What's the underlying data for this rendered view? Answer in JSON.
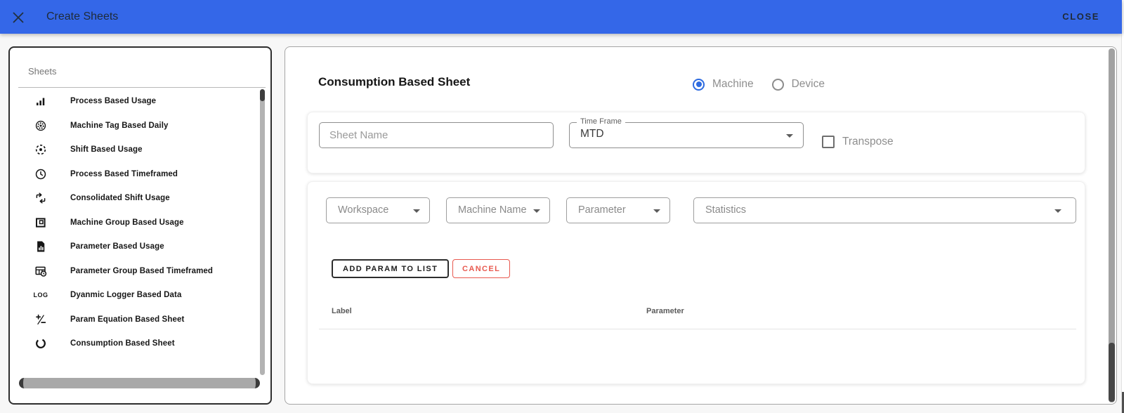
{
  "header": {
    "title": "Create Sheets",
    "close_label": "CLOSE"
  },
  "sidebar": {
    "title": "Sheets",
    "items": [
      {
        "label": "Process Based Usage",
        "icon": "bar-chart-icon"
      },
      {
        "label": "Machine Tag Based Daily",
        "icon": "gear-circle-icon"
      },
      {
        "label": "Shift Based Usage",
        "icon": "dashed-circle-icon"
      },
      {
        "label": "Process Based Timeframed",
        "icon": "clock-icon"
      },
      {
        "label": "Consolidated Shift Usage",
        "icon": "merge-arrows-icon"
      },
      {
        "label": "Machine Group Based Usage",
        "icon": "nested-squares-icon"
      },
      {
        "label": "Parameter Based Usage",
        "icon": "document-chart-icon"
      },
      {
        "label": "Parameter Group Based Timeframed",
        "icon": "table-clock-icon"
      },
      {
        "label": "Dyanmic Logger Based Data",
        "icon": "log-icon"
      },
      {
        "label": "Param Equation Based Sheet",
        "icon": "plus-minus-icon"
      },
      {
        "label": "Consumption Based Sheet",
        "icon": "loop-icon"
      }
    ]
  },
  "main": {
    "title": "Consumption Based Sheet",
    "radio_group": {
      "options": [
        {
          "label": "Machine",
          "selected": true
        },
        {
          "label": "Device",
          "selected": false
        }
      ]
    },
    "form": {
      "sheet_name_placeholder": "Sheet Name",
      "time_frame_label": "Time Frame",
      "time_frame_value": "MTD",
      "transpose_label": "Transpose",
      "transpose_checked": false
    },
    "param_form": {
      "dropdowns": [
        {
          "label": "Workspace"
        },
        {
          "label": "Machine Name"
        },
        {
          "label": "Parameter"
        },
        {
          "label": "Statistics"
        }
      ],
      "add_button_label": "ADD PARAM TO LIST",
      "cancel_button_label": "CANCEL",
      "table": {
        "columns": [
          "Label",
          "Parameter"
        ],
        "rows": []
      }
    }
  },
  "colors": {
    "header_bg": "#3467e8",
    "radio_selected": "#2e6be0",
    "cancel_red": "#e8594f"
  }
}
